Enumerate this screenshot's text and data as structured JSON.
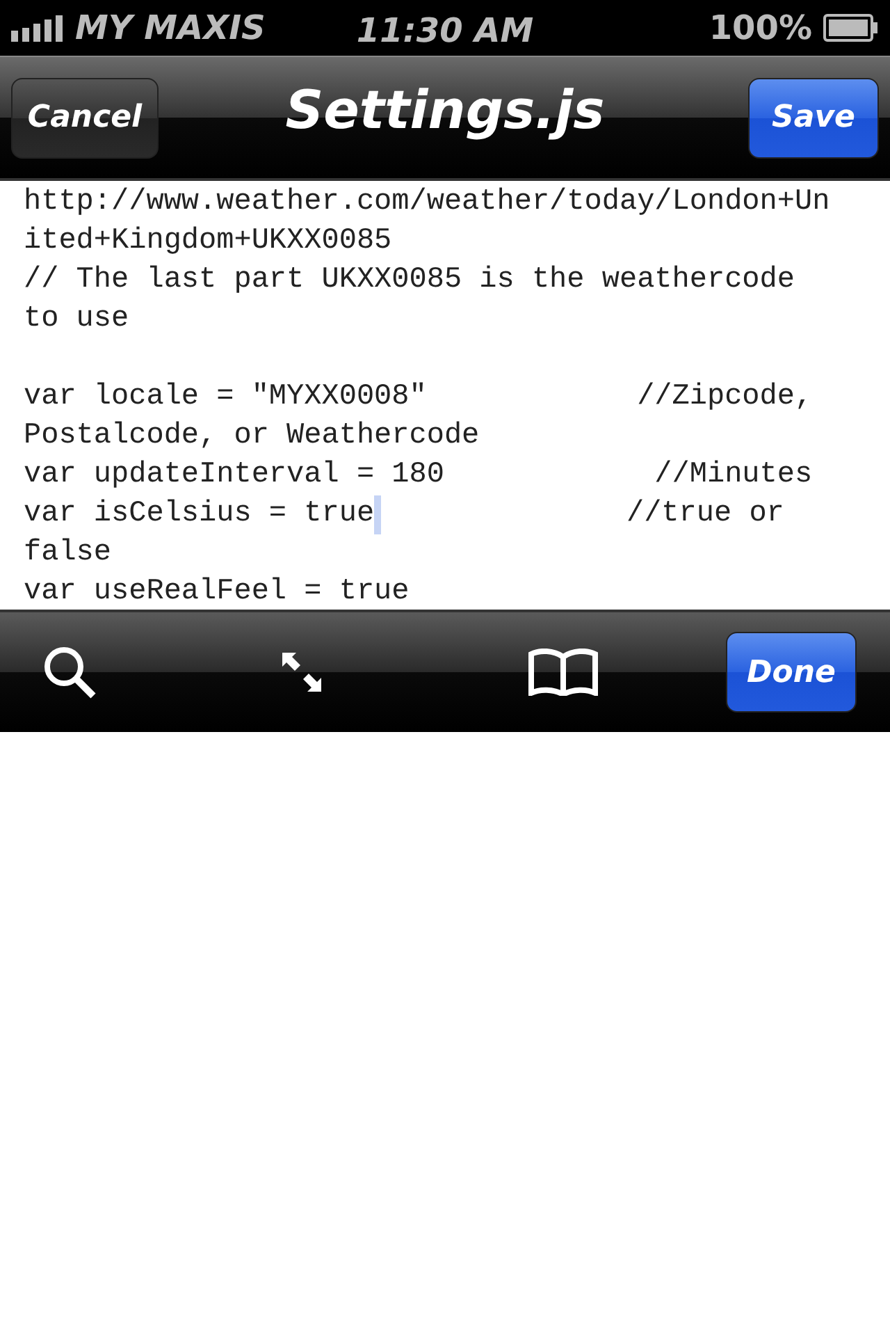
{
  "status_bar": {
    "carrier": "MY MAXIS",
    "time": "11:30 AM",
    "battery": "100%"
  },
  "nav_bar": {
    "left_button": "Cancel",
    "title": "Settings.js",
    "right_button": "Save"
  },
  "editor": {
    "lines": [
      {
        "kind": "code",
        "text": "http://www.weather.com/weather/today/London+Un",
        "caret": false
      },
      {
        "kind": "code",
        "text": "ited+Kingdom+UKXX0085",
        "caret": false
      },
      {
        "kind": "code",
        "text": "// The last part UKXX0085 is the weathercode",
        "caret": false
      },
      {
        "kind": "code",
        "text": "to use",
        "caret": false
      },
      {
        "kind": "blank",
        "caret": false
      },
      {
        "kind": "code",
        "text": "var locale = \"MYXX0008\"            //Zipcode,",
        "caret": false
      },
      {
        "kind": "code",
        "text": "Postalcode, or Weathercode",
        "caret": false
      },
      {
        "kind": "code",
        "text": "var updateInterval = 180            //Minutes",
        "caret": false
      },
      {
        "kind": "code",
        "text": "var isCelsius = true               //true or",
        "caret": true
      },
      {
        "kind": "code",
        "text": "false",
        "caret": false
      },
      {
        "kind": "code",
        "text": "var useRealFeel = true",
        "caret": false
      }
    ]
  },
  "toolbar": {
    "done_button": "Done"
  }
}
